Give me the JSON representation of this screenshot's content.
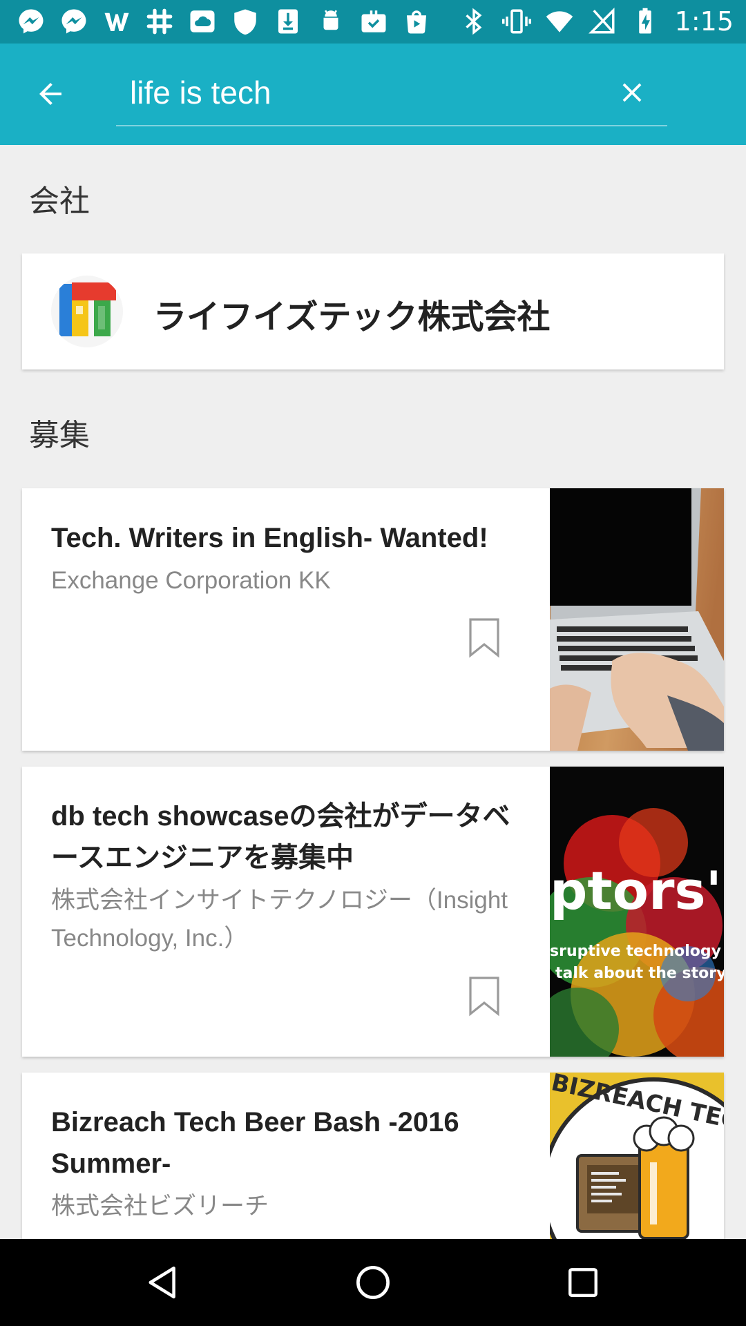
{
  "status_bar": {
    "time": "1:15",
    "left_icons": [
      "messenger-icon",
      "messenger-icon",
      "wordpress-icon",
      "slack-icon",
      "cloud-icon",
      "shield-icon",
      "download-icon",
      "android-icon",
      "briefcase-check-icon",
      "shopping-bag-icon"
    ],
    "right_icons": [
      "bluetooth-icon",
      "vibrate-icon",
      "wifi-icon",
      "no-signal-icon",
      "battery-charging-icon"
    ]
  },
  "search": {
    "query": "life is tech"
  },
  "sections": {
    "company": "会社",
    "jobs": "募集"
  },
  "company": {
    "name": "ライフイズテック株式会社"
  },
  "jobs": [
    {
      "title": "Tech. Writers in English- Wanted!",
      "company": "Exchange Corporation KK"
    },
    {
      "title": "db tech showcaseの会社がデータベースエンジニアを募集中",
      "company": "株式会社インサイトテクノロジー（Insight Technology, Inc.）",
      "image_text_1": "ptors'",
      "image_text_2": "sruptive technology a",
      "image_text_3": "talk about the story"
    },
    {
      "title": "Bizreach Tech Beer Bash -2016 Summer-",
      "company": "株式会社ビズリーチ",
      "image_text": "BIZREACH TECH"
    }
  ],
  "colors": {
    "status_bar": "#0e8f9f",
    "app_bar": "#1ab0c5",
    "background": "#efefef"
  }
}
